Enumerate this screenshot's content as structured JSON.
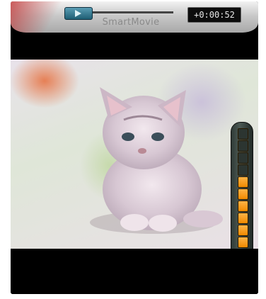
{
  "player": {
    "brand": "SmartMovie",
    "timecode": "+0:00:52",
    "volume": {
      "level": 8,
      "max": 12
    },
    "colors": {
      "accent_orange": "#f08a00",
      "seek_knob": "#2f7a92"
    }
  },
  "icons": {
    "play": "play-icon",
    "volume": "speaker-icon"
  }
}
